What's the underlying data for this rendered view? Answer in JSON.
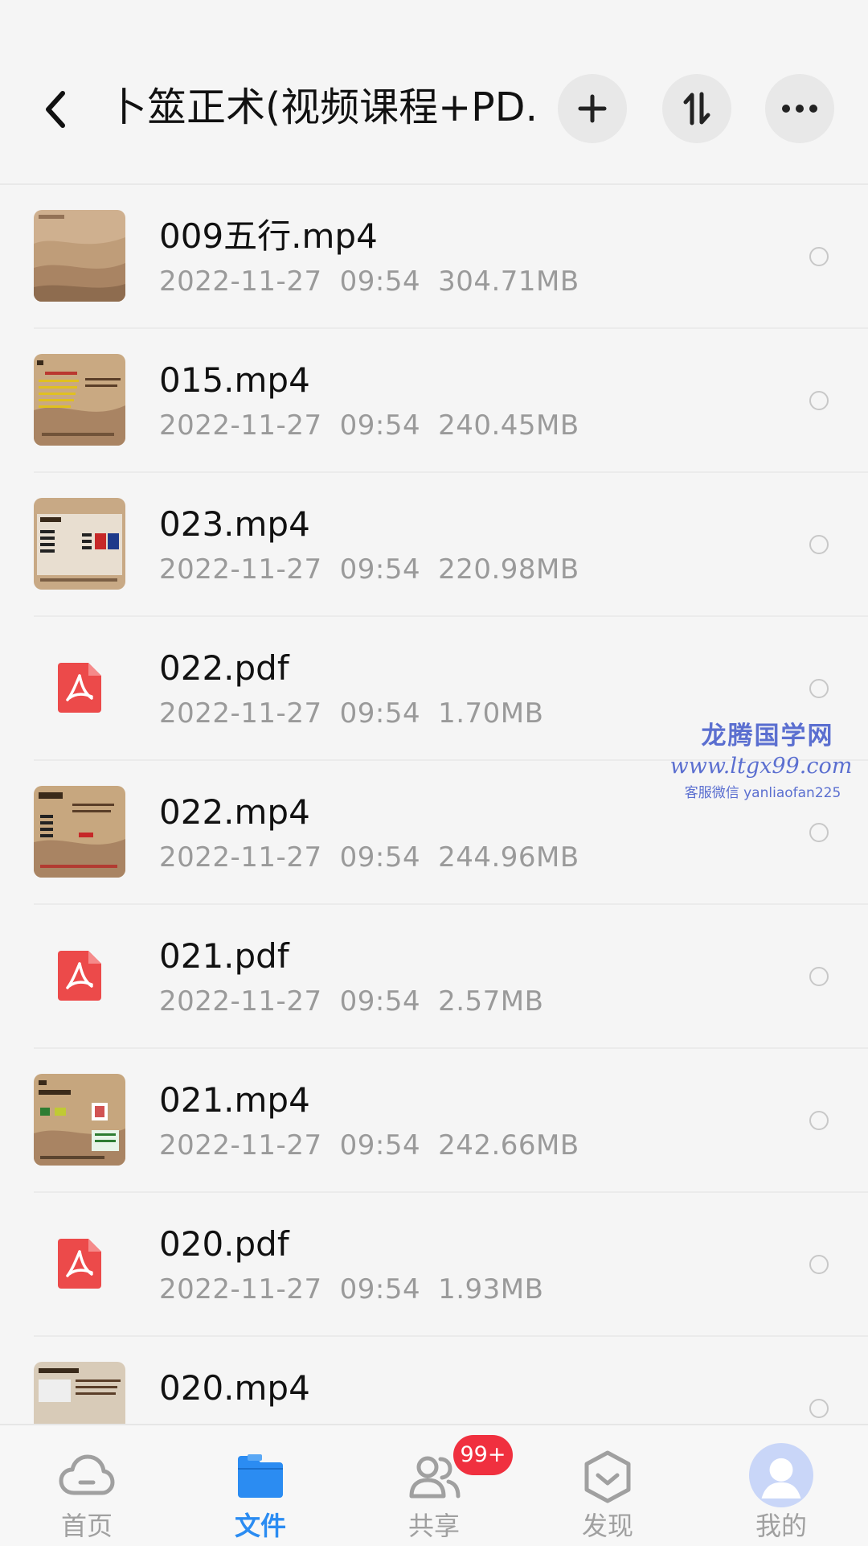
{
  "header": {
    "title": "卜筮正术(视频课程+PD...",
    "back_icon": "chevron-left-icon",
    "add_icon": "plus-icon",
    "sort_icon": "sort-icon",
    "more_icon": "more-horizontal-icon"
  },
  "files": [
    {
      "name": "009五行.mp4",
      "date": "2022-11-27",
      "time": "09:54",
      "size": "304.71MB",
      "type": "video"
    },
    {
      "name": "015.mp4",
      "date": "2022-11-27",
      "time": "09:54",
      "size": "240.45MB",
      "type": "video"
    },
    {
      "name": "023.mp4",
      "date": "2022-11-27",
      "time": "09:54",
      "size": "220.98MB",
      "type": "video"
    },
    {
      "name": "022.pdf",
      "date": "2022-11-27",
      "time": "09:54",
      "size": "1.70MB",
      "type": "pdf"
    },
    {
      "name": "022.mp4",
      "date": "2022-11-27",
      "time": "09:54",
      "size": "244.96MB",
      "type": "video"
    },
    {
      "name": "021.pdf",
      "date": "2022-11-27",
      "time": "09:54",
      "size": "2.57MB",
      "type": "pdf"
    },
    {
      "name": "021.mp4",
      "date": "2022-11-27",
      "time": "09:54",
      "size": "242.66MB",
      "type": "video"
    },
    {
      "name": "020.pdf",
      "date": "2022-11-27",
      "time": "09:54",
      "size": "1.93MB",
      "type": "pdf"
    },
    {
      "name": "020.mp4",
      "date": "",
      "time": "",
      "size": "",
      "type": "video"
    }
  ],
  "watermark": {
    "title": "龙腾国学网",
    "url": "www.ltgx99.com",
    "wechat": "客服微信 yanliaofan225"
  },
  "bottom_nav": {
    "items": [
      {
        "label": "首页",
        "icon": "cloud-icon",
        "active": false
      },
      {
        "label": "文件",
        "icon": "folder-icon",
        "active": true
      },
      {
        "label": "共享",
        "icon": "people-icon",
        "active": false
      },
      {
        "label": "发现",
        "icon": "discover-icon",
        "active": false
      },
      {
        "label": "我的",
        "icon": "avatar-icon",
        "active": false
      }
    ],
    "share_badge": "99+"
  },
  "colors": {
    "accent": "#2b8cf2",
    "badge": "#f0303f",
    "pdf": "#ec4a4a",
    "watermark": "#5b6fd0"
  }
}
